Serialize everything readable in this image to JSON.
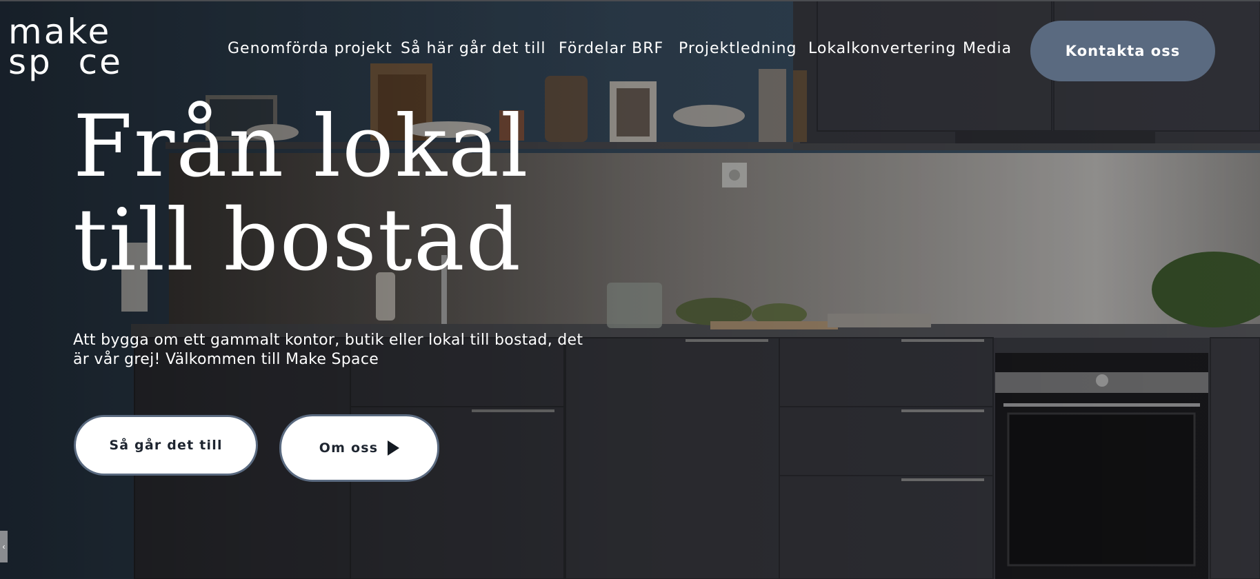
{
  "brand": {
    "logo_line1": "make",
    "logo_line2": "sp  ce"
  },
  "nav": {
    "items": [
      {
        "label": "Genomförda projekt"
      },
      {
        "label": "Så här går det till"
      },
      {
        "label": "Fördelar BRF"
      },
      {
        "label": "Projektledning"
      },
      {
        "label": "Lokalkonvertering"
      },
      {
        "label": "Media"
      }
    ],
    "contact_label": "Kontakta oss"
  },
  "hero": {
    "title_line1": "Från lokal",
    "title_line2": "till bostad",
    "lead": "Att bygga om ett gammalt kontor, butik eller lokal till bostad, det är vår grej! Välkommen till Make Space",
    "cta_how": "Så går det till",
    "cta_about": "Om oss"
  },
  "side_tab": {
    "label": "‹"
  },
  "colors": {
    "contact_button": "#5a6a80",
    "wall": "#3d5468",
    "cabinets": "#3a3b42",
    "text": "#ffffff"
  },
  "icons": {
    "play": "play-icon"
  }
}
